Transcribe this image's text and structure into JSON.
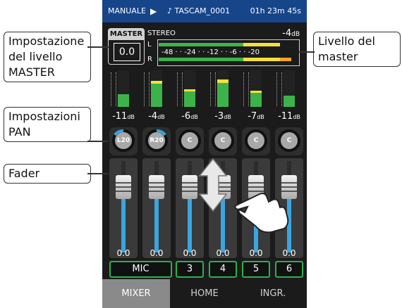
{
  "statusbar": {
    "mode": "MANUALE",
    "play_icon": "play-icon",
    "file": "♪ TASCAM_0001",
    "time": "01h 23m 45s"
  },
  "master": {
    "button_label": "MASTER",
    "value": "0.0",
    "stereo_label": "STEREO",
    "level_db": "-4",
    "unit": "dB",
    "L": "L",
    "R": "R",
    "scale": [
      "-48",
      "-24",
      "-12",
      "-6",
      "-20"
    ]
  },
  "channels": [
    {
      "db": "-11",
      "pan": "L20",
      "fader_value": "0.0",
      "label": "MIC"
    },
    {
      "db": "-4",
      "pan": "R20",
      "fader_value": "0.0",
      "label": ""
    },
    {
      "db": "-6",
      "pan": "C",
      "fader_value": "0.0",
      "label": "3"
    },
    {
      "db": "-3",
      "pan": "C",
      "fader_value": "0.0",
      "label": "4"
    },
    {
      "db": "-7",
      "pan": "C",
      "fader_value": "0.0",
      "label": "5"
    },
    {
      "db": "-11",
      "pan": "C",
      "fader_value": "0.0",
      "label": "6"
    }
  ],
  "tabs": [
    "MIXER",
    "HOME",
    "INGR."
  ],
  "callouts": {
    "master_setting": "Impostazione del livello MASTER",
    "master_level": "Livello del master",
    "pan": "Impostazioni PAN",
    "fader": "Fader"
  },
  "colors": {
    "status_bg": "#16458a",
    "meter_green": "#3cb34a",
    "meter_yellow": "#f2e23a",
    "meter_orange": "#f5a623",
    "accent_blue": "#3aa6e0",
    "label_border": "#2bb24c"
  }
}
